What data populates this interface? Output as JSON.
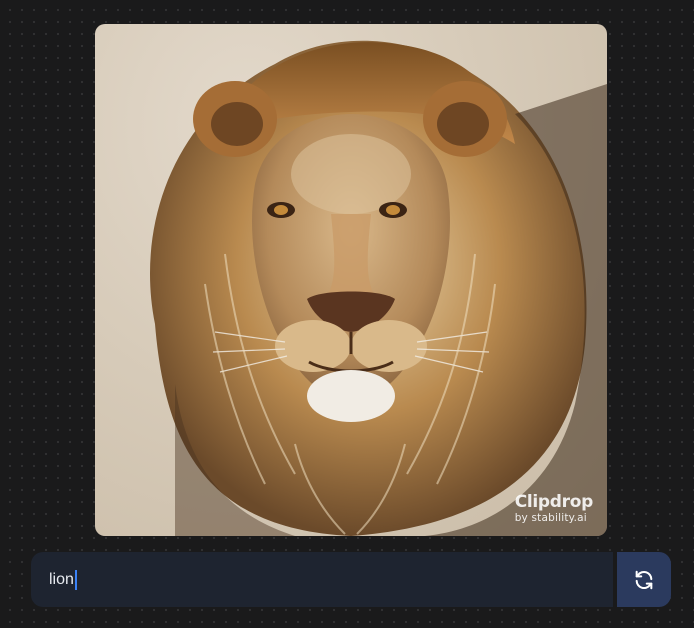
{
  "generated_image": {
    "subject": "lion",
    "watermark": {
      "brand": "Clipdrop",
      "byline": "by stability.ai"
    }
  },
  "prompt": {
    "value": "lion"
  },
  "regenerate_button": {
    "icon": "refresh-icon"
  },
  "colors": {
    "page_background": "#1a1a1b",
    "prompt_bar": "#1e2430",
    "button": "#2b3a5e",
    "caret": "#3b82f6"
  }
}
